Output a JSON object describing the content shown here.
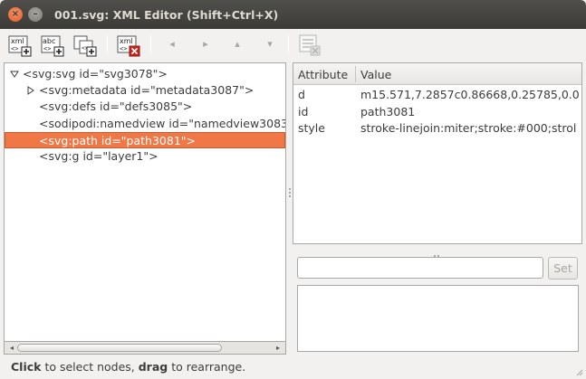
{
  "window": {
    "title": "001.svg: XML Editor (Shift+Ctrl+X)",
    "close_glyph": "×",
    "min_glyph": "–"
  },
  "toolbar": {
    "new_element_node": "new-element-node-icon",
    "new_text_node": "new-text-node-icon",
    "duplicate_node": "duplicate-node-icon",
    "delete_node": "delete-node-icon",
    "unindent": "◂",
    "indent": "▸",
    "raise": "▴",
    "lower": "▾",
    "delete_attribute": "delete-attribute-icon",
    "icon_text_xml": "xml",
    "icon_text_abc": "abc"
  },
  "tree": {
    "nodes": [
      {
        "label": "<svg:svg id=\"svg3078\">",
        "depth": 0,
        "expander": "open"
      },
      {
        "label": "<svg:metadata id=\"metadata3087\">",
        "depth": 1,
        "expander": "closed"
      },
      {
        "label": "<svg:defs id=\"defs3085\">",
        "depth": 1,
        "expander": "none"
      },
      {
        "label": "<sodipodi:namedview id=\"namedview3083",
        "depth": 1,
        "expander": "none"
      },
      {
        "label": "<svg:path id=\"path3081\">",
        "depth": 1,
        "expander": "none",
        "selected": true
      },
      {
        "label": "<svg:g id=\"layer1\">",
        "depth": 1,
        "expander": "none"
      }
    ]
  },
  "attributes": {
    "col_attribute": "Attribute",
    "col_value": "Value",
    "rows": [
      {
        "name": "d",
        "value": "m15.571,7.2857c0.86668,0.25785,0.0"
      },
      {
        "name": "id",
        "value": "path3081"
      },
      {
        "name": "style",
        "value": "stroke-linejoin:miter;stroke:#000;strol"
      }
    ]
  },
  "editor": {
    "value_text": "",
    "set_label": "Set"
  },
  "status": {
    "part1": "Click",
    "part2": " to select nodes, ",
    "part3": "drag",
    "part4": " to rearrange."
  },
  "colors": {
    "selection": "#f07746",
    "titlebar": "#3c3b37",
    "close_button": "#e05a27"
  }
}
